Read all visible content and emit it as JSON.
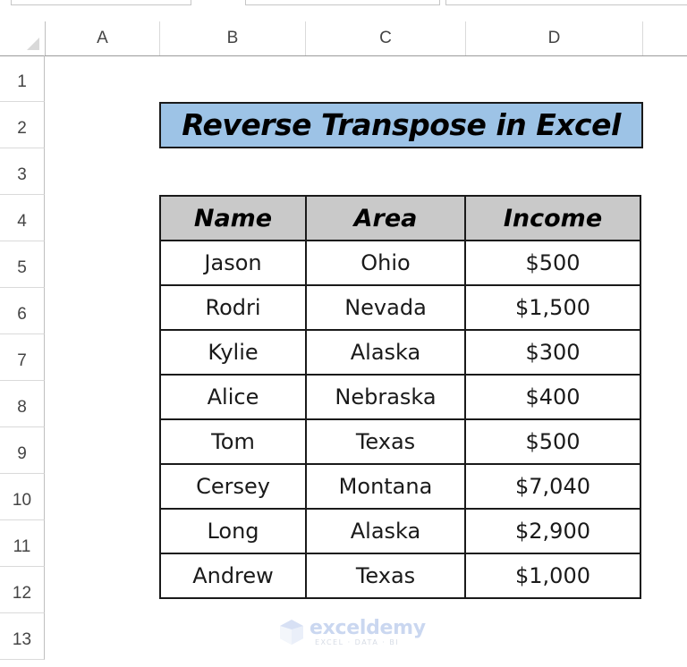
{
  "columns": [
    "A",
    "B",
    "C",
    "D"
  ],
  "rows": [
    "1",
    "2",
    "3",
    "4",
    "5",
    "6",
    "7",
    "8",
    "9",
    "10",
    "11",
    "12",
    "13"
  ],
  "title": "Reverse Transpose in Excel",
  "table": {
    "headers": [
      "Name",
      "Area",
      "Income"
    ],
    "rows": [
      [
        "Jason",
        "Ohio",
        "$500"
      ],
      [
        "Rodri",
        "Nevada",
        "$1,500"
      ],
      [
        "Kylie",
        "Alaska",
        "$300"
      ],
      [
        "Alice",
        "Nebraska",
        "$400"
      ],
      [
        "Tom",
        "Texas",
        "$500"
      ],
      [
        "Cersey",
        "Montana",
        "$7,040"
      ],
      [
        "Long",
        "Alaska",
        "$2,900"
      ],
      [
        "Andrew",
        "Texas",
        "$1,000"
      ]
    ]
  },
  "watermark": {
    "name": "exceldemy",
    "tagline": "EXCEL · DATA · BI"
  },
  "colors": {
    "title_fill": "#9dc3e6",
    "header_fill": "#c9c9c9"
  }
}
